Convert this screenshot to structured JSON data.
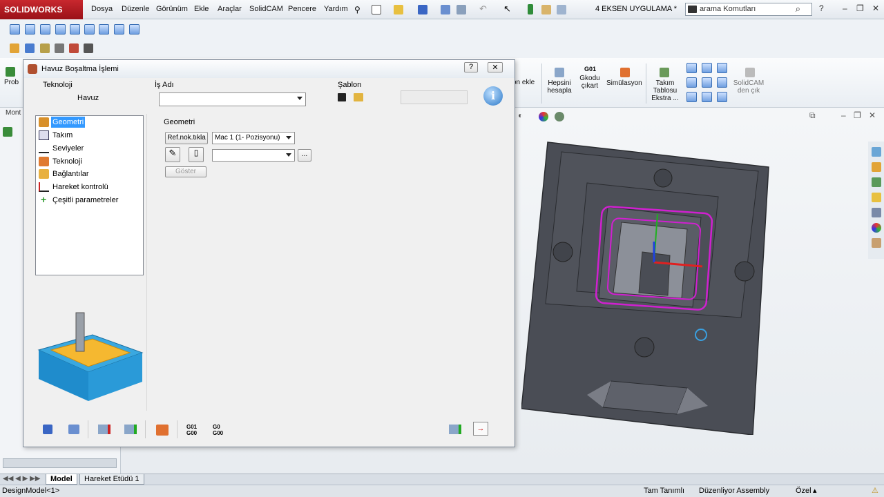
{
  "app": {
    "brand": "SOLIDWORKS",
    "document_title": "4 EKSEN UYGULAMA *"
  },
  "menu": [
    "Dosya",
    "Düzenle",
    "Görünüm",
    "Ekle",
    "Araçlar",
    "SolidCAM",
    "Pencere",
    "Yardım"
  ],
  "search": {
    "placeholder": "arama Komutları"
  },
  "command_manager": {
    "left_label": "Prob",
    "items": [
      {
        "label": "on ekle"
      },
      {
        "label": "Hepsini hesapla"
      },
      {
        "label": "Gkodu çıkart",
        "top": "G01"
      },
      {
        "label": "Simülasyon"
      },
      {
        "label": "Takım Tablosu Ekstra ..."
      },
      {
        "label": "SolidCAM den çık"
      }
    ]
  },
  "left_tab": "Mont",
  "dialog": {
    "title": "Havuz Boşaltma İşlemi",
    "help": "?",
    "close": "✕",
    "technology_label": "Teknoloji",
    "technology_value": "Havuz",
    "job_name_label": "İş Adı",
    "job_name_value": "",
    "template_label": "Şablon",
    "tree": [
      {
        "label": "Geometri",
        "selected": true
      },
      {
        "label": "Takım"
      },
      {
        "label": "Seviyeler"
      },
      {
        "label": "Teknoloji"
      },
      {
        "label": "Bağlantılar"
      },
      {
        "label": "Hareket kontrolü"
      },
      {
        "label": "Çeşitli parametreler"
      }
    ],
    "geometry": {
      "group_label": "Geometri",
      "ref_button": "Ref.nok.tıkla",
      "mac_select": "Mac 1 (1- Pozisyonu)",
      "geometry_select": "",
      "browse_button": "...",
      "show_button": "Göster"
    },
    "bottom": {
      "g1": "G01",
      "g2": "G00",
      "g3": "G0",
      "g4": "G00"
    }
  },
  "bottom_tabs": [
    "Model",
    "Hareket Etüdü 1"
  ],
  "status": {
    "left": "DesignModel<1>",
    "defined": "Tam Tanımlı",
    "editing": "Düzenliyor Assembly",
    "custom": "Özel"
  },
  "colors": {
    "accent": "#c8282e",
    "selection": "#3399ff",
    "model": "#4a4d55",
    "profile": "#d020d0"
  }
}
